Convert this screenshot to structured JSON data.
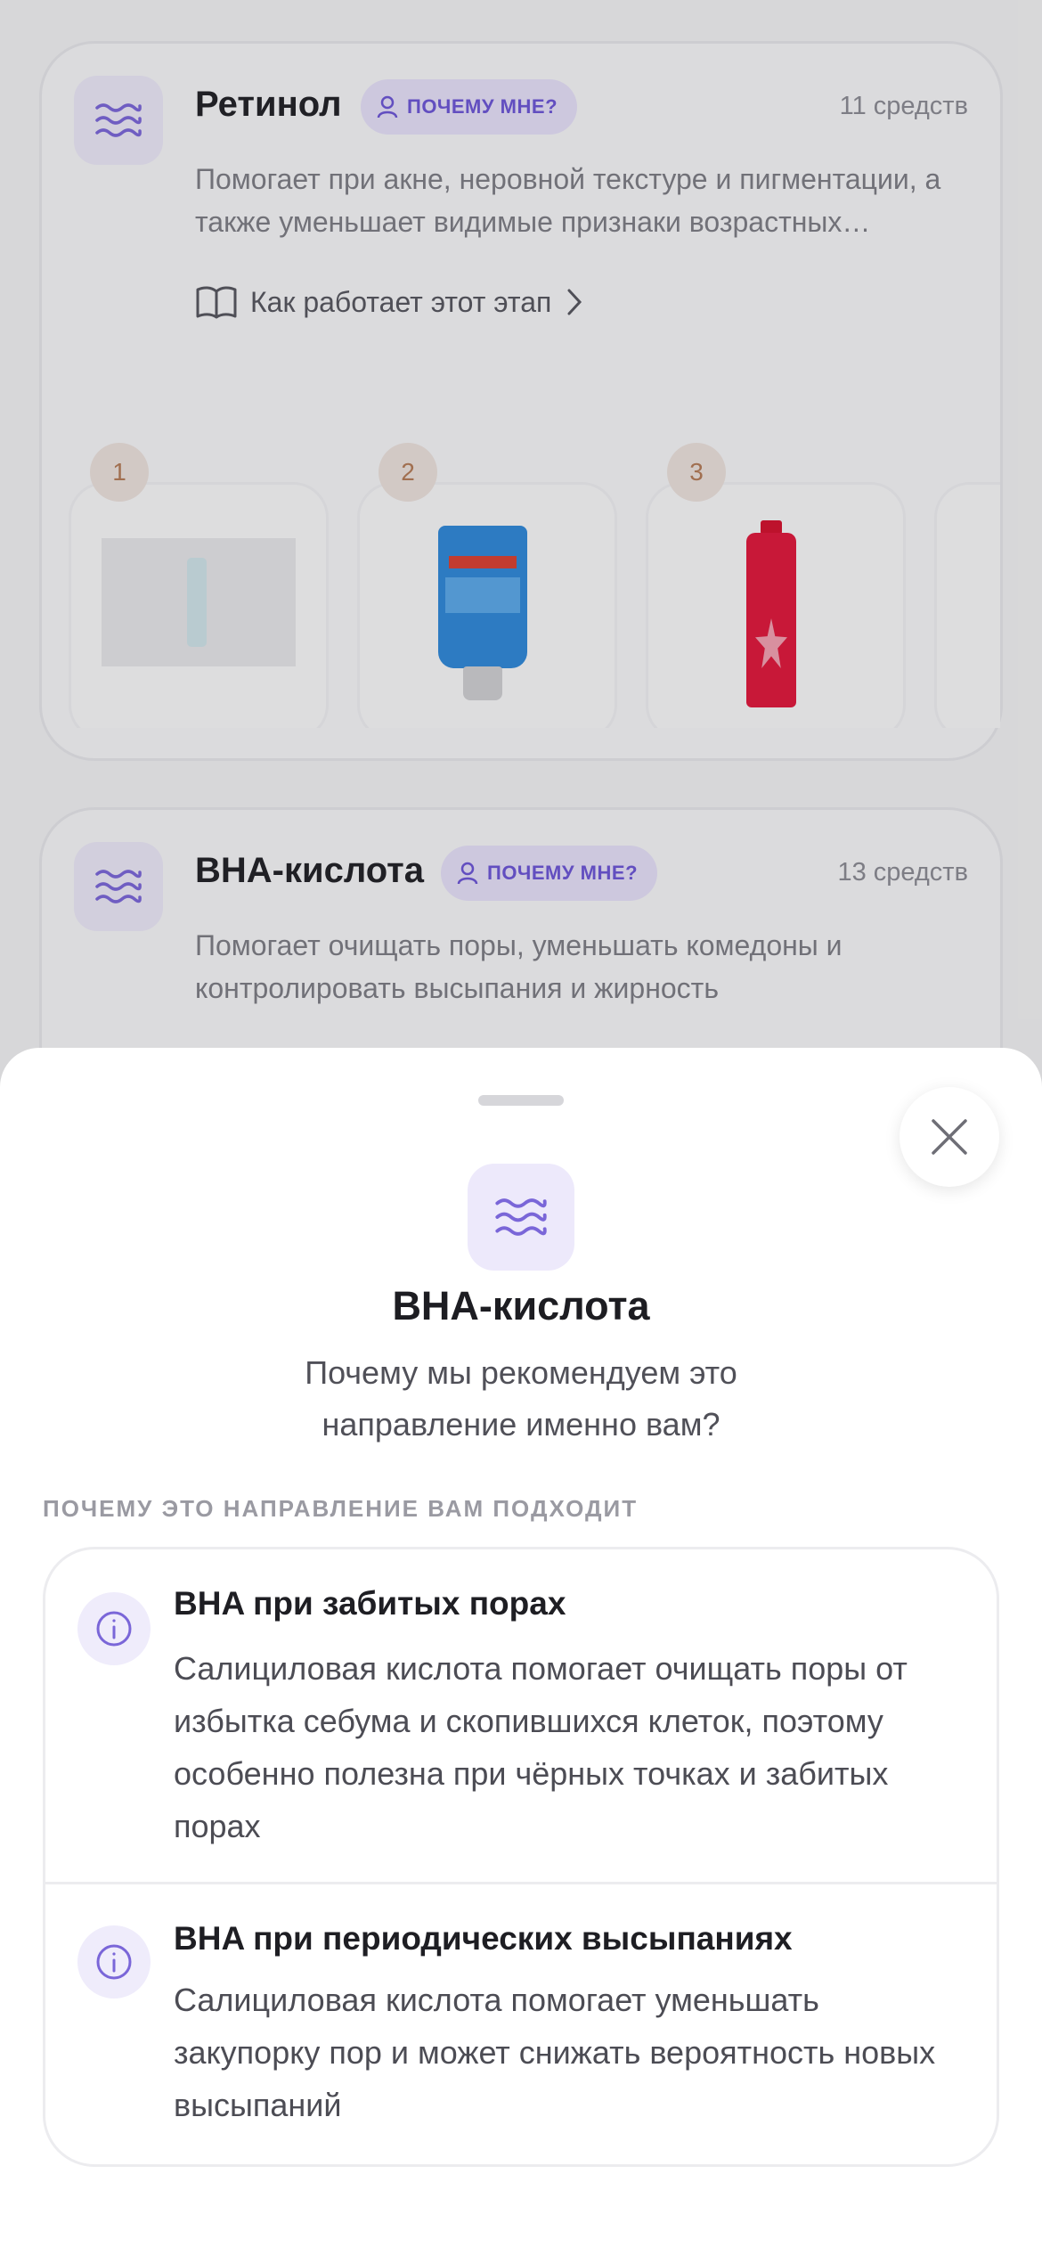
{
  "cards": [
    {
      "title": "Ретинол",
      "badge": "ПОЧЕМУ МНЕ?",
      "count": "11 средств",
      "description": "Помогает при акне, неровной текстуре и пигментации, а также уменьшает видимые признаки возрастных…",
      "how_link": "Как работает этот этап",
      "products": [
        "1",
        "2",
        "3"
      ]
    },
    {
      "title": "BHA-кислота",
      "badge": "ПОЧЕМУ МНЕ?",
      "count": "13 средств",
      "description": "Помогает очищать поры, уменьшать комедоны и контролировать высыпания и жирность"
    }
  ],
  "sheet": {
    "title": "BHA-кислота",
    "subtitle": "Почему мы рекомендуем это направление именно вам?",
    "section_label": "ПОЧЕМУ ЭТО НАПРАВЛЕНИЕ ВАМ ПОДХОДИТ",
    "reasons": [
      {
        "title": "BHA при забитых порах",
        "text": "Салициловая кислота помогает очищать поры от избытка себума и скопившихся клеток, поэтому особенно полезна при чёрных точках и забитых порах"
      },
      {
        "title": "BHA при периодических высыпаниях",
        "text": "Салициловая кислота помогает уменьшать закупорку пор и может снижать вероятность новых высыпаний"
      }
    ]
  },
  "colors": {
    "accent": "#6b54d6",
    "accent_soft": "#ede9fb",
    "badge_number": "#b47a56"
  }
}
